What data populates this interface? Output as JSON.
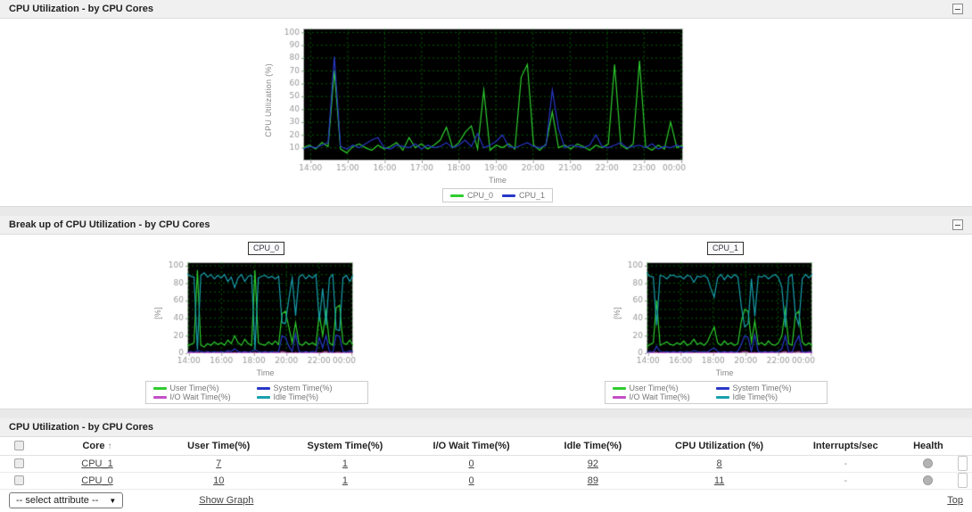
{
  "panels": {
    "cpu_util": {
      "title": "CPU Utilization - by CPU Cores"
    },
    "breakup": {
      "title": "Break up of CPU Utilization - by CPU Cores"
    },
    "table_panel": {
      "title": "CPU Utilization - by CPU Cores"
    }
  },
  "chart_data": [
    {
      "type": "line",
      "title": "CPU Utilization - by CPU Cores",
      "xlabel": "Time",
      "ylabel": "CPU Utilization (%)",
      "bg": "#000000",
      "grid": true,
      "grid_color": "rgba(0,180,0,0.75)",
      "grid_step_y": 10,
      "ylim": [
        0,
        103
      ],
      "y_ticks": [
        10,
        20,
        30,
        40,
        50,
        60,
        70,
        80,
        90,
        100
      ],
      "x_start_hour": 13.8,
      "x_end_hour": 24.05,
      "x_tick_hours": [
        14,
        15,
        16,
        17,
        18,
        19,
        20,
        21,
        22,
        23,
        24
      ],
      "x_tick_labels": [
        "14:00",
        "15:00",
        "16:00",
        "17:00",
        "18:00",
        "19:00",
        "20:00",
        "21:00",
        "22:00",
        "23:00",
        "00:00"
      ],
      "legend_position": "bottom",
      "series": [
        {
          "name": "CPU_0",
          "color": "#2ecc2e",
          "values": [
            10,
            12,
            9,
            14,
            11,
            70,
            9,
            6,
            11,
            13,
            10,
            8,
            12,
            9,
            11,
            14,
            8,
            18,
            10,
            13,
            9,
            12,
            16,
            26,
            10,
            14,
            22,
            27,
            9,
            55,
            8,
            12,
            10,
            13,
            9,
            65,
            75,
            12,
            8,
            13,
            38,
            10,
            12,
            9,
            13,
            11,
            8,
            12,
            10,
            13,
            75,
            12,
            9,
            13,
            78,
            11,
            8,
            12,
            9,
            30,
            10,
            12
          ]
        },
        {
          "name": "CPU_1",
          "color": "#2838c8",
          "values": [
            9,
            11,
            10,
            12,
            14,
            81,
            11,
            9,
            12,
            10,
            13,
            16,
            18,
            10,
            9,
            12,
            11,
            10,
            13,
            9,
            12,
            10,
            11,
            14,
            10,
            12,
            16,
            11,
            21,
            10,
            12,
            15,
            20,
            11,
            10,
            12,
            14,
            11,
            10,
            12,
            55,
            25,
            10,
            12,
            11,
            10,
            12,
            20,
            11,
            10,
            12,
            14,
            10,
            11,
            12,
            10,
            13,
            9,
            11,
            10,
            12,
            10
          ]
        }
      ]
    },
    {
      "type": "line",
      "box_label": "CPU_0",
      "xlabel": "Time",
      "ylabel": "[%]",
      "bg": "#000000",
      "grid": true,
      "grid_color": "rgba(0,180,0,0.75)",
      "grid_step_y": 10,
      "ylim": [
        0,
        104
      ],
      "y_ticks": [
        0,
        20,
        40,
        60,
        80,
        100
      ],
      "x_start_hour": 13.9,
      "x_end_hour": 24.1,
      "x_tick_hours": [
        14,
        16,
        18,
        20,
        22,
        24
      ],
      "x_tick_labels": [
        "14:00",
        "16:00",
        "18:00",
        "20:00",
        "22:00",
        "00:00"
      ],
      "legend_position": "bottom",
      "series": [
        {
          "name": "User Time(%)",
          "color": "#2ecc2e",
          "values": [
            8,
            10,
            12,
            95,
            9,
            7,
            11,
            9,
            13,
            10,
            12,
            9,
            15,
            11,
            20,
            12,
            9,
            16,
            11,
            9,
            95,
            12,
            10,
            9,
            13,
            10,
            14,
            10,
            45,
            48,
            30,
            12,
            35,
            11,
            9,
            13,
            10,
            12,
            9,
            45,
            20,
            48,
            12,
            9,
            52,
            55,
            12,
            10,
            15,
            9
          ]
        },
        {
          "name": "System Time(%)",
          "color": "#2838c8",
          "values": [
            1,
            2,
            1,
            3,
            2,
            1,
            2,
            1,
            2,
            1,
            2,
            1,
            3,
            2,
            5,
            2,
            1,
            2,
            1,
            2,
            4,
            2,
            1,
            2,
            1,
            2,
            1,
            2,
            20,
            18,
            8,
            2,
            22,
            2,
            1,
            2,
            1,
            2,
            1,
            18,
            6,
            20,
            2,
            1,
            21,
            19,
            2,
            1,
            3,
            2
          ]
        },
        {
          "name": "I/O Wait Time(%)",
          "color": "#c44ec4",
          "values": [
            0,
            1,
            0,
            1,
            0,
            0,
            1,
            0,
            0,
            1,
            0,
            0,
            1,
            0,
            1,
            0,
            0,
            1,
            0,
            0,
            1,
            0,
            0,
            1,
            0,
            0,
            1,
            0,
            2,
            1,
            0,
            0,
            1,
            0,
            0,
            1,
            0,
            0,
            1,
            0,
            1,
            2,
            0,
            0,
            1,
            1,
            0,
            0,
            1,
            0
          ]
        },
        {
          "name": "Idle Time(%)",
          "color": "#18a0ae",
          "values": [
            91,
            88,
            87,
            4,
            89,
            92,
            87,
            90,
            85,
            89,
            86,
            90,
            82,
            87,
            75,
            86,
            90,
            82,
            88,
            89,
            4,
            86,
            88,
            89,
            86,
            88,
            85,
            88,
            35,
            34,
            62,
            86,
            43,
            87,
            90,
            85,
            89,
            86,
            90,
            37,
            74,
            32,
            86,
            90,
            27,
            26,
            86,
            89,
            82,
            89
          ]
        }
      ]
    },
    {
      "type": "line",
      "box_label": "CPU_1",
      "xlabel": "Time",
      "ylabel": "[%]",
      "bg": "#000000",
      "grid": true,
      "grid_color": "rgba(0,180,0,0.75)",
      "grid_step_y": 10,
      "ylim": [
        0,
        104
      ],
      "y_ticks": [
        0,
        20,
        40,
        60,
        80,
        100
      ],
      "x_start_hour": 13.9,
      "x_end_hour": 24.1,
      "x_tick_hours": [
        14,
        16,
        18,
        20,
        22,
        24
      ],
      "x_tick_labels": [
        "14:00",
        "16:00",
        "18:00",
        "20:00",
        "22:00",
        "00:00"
      ],
      "legend_position": "bottom",
      "series": [
        {
          "name": "User Time(%)",
          "color": "#2ecc2e",
          "values": [
            7,
            10,
            12,
            60,
            9,
            11,
            13,
            10,
            9,
            12,
            10,
            14,
            9,
            11,
            16,
            10,
            12,
            9,
            13,
            22,
            30,
            12,
            9,
            14,
            10,
            12,
            9,
            11,
            36,
            50,
            48,
            13,
            37,
            10,
            12,
            9,
            14,
            10,
            9,
            12,
            20,
            50,
            11,
            9,
            44,
            48,
            13,
            9,
            12,
            8
          ]
        },
        {
          "name": "System Time(%)",
          "color": "#2838c8",
          "values": [
            1,
            2,
            1,
            8,
            2,
            1,
            2,
            1,
            2,
            1,
            2,
            1,
            2,
            1,
            3,
            2,
            1,
            2,
            1,
            4,
            6,
            2,
            1,
            2,
            1,
            2,
            1,
            2,
            10,
            20,
            18,
            2,
            21,
            2,
            1,
            2,
            1,
            2,
            1,
            2,
            5,
            20,
            2,
            1,
            12,
            20,
            2,
            1,
            2,
            1
          ]
        },
        {
          "name": "I/O Wait Time(%)",
          "color": "#c44ec4",
          "values": [
            0,
            0,
            1,
            1,
            0,
            1,
            0,
            0,
            1,
            0,
            1,
            0,
            0,
            1,
            0,
            0,
            1,
            0,
            1,
            0,
            1,
            0,
            0,
            1,
            0,
            1,
            0,
            0,
            1,
            2,
            1,
            0,
            1,
            0,
            0,
            1,
            0,
            1,
            0,
            0,
            1,
            2,
            0,
            1,
            1,
            2,
            0,
            0,
            1,
            0
          ]
        },
        {
          "name": "Idle Time(%)",
          "color": "#18a0ae",
          "values": [
            92,
            88,
            87,
            32,
            89,
            88,
            85,
            89,
            89,
            87,
            88,
            85,
            89,
            88,
            81,
            88,
            87,
            89,
            86,
            74,
            64,
            86,
            90,
            84,
            89,
            86,
            90,
            87,
            54,
            30,
            34,
            85,
            42,
            88,
            87,
            89,
            85,
            88,
            90,
            86,
            75,
            30,
            87,
            90,
            44,
            32,
            85,
            90,
            86,
            91
          ]
        }
      ]
    }
  ],
  "table": {
    "sort_arrow": "↑",
    "headers": {
      "core": "Core",
      "user": "User Time(%)",
      "system": "System Time(%)",
      "iowait": "I/O Wait Time(%)",
      "idle": "Idle Time(%)",
      "cpu": "CPU Utilization (%)",
      "interrupts": "Interrupts/sec",
      "health": "Health"
    },
    "rows": [
      {
        "core": "CPU_1",
        "user": "7",
        "system": "1",
        "iowait": "0",
        "idle": "92",
        "cpu": "8",
        "interrupts": "-"
      },
      {
        "core": "CPU_0",
        "user": "10",
        "system": "1",
        "iowait": "0",
        "idle": "89",
        "cpu": "11",
        "interrupts": "-"
      }
    ]
  },
  "footer": {
    "select_label": "-- select attribute --",
    "select_caret": "▼",
    "show_graph": "Show Graph",
    "top": "Top"
  }
}
